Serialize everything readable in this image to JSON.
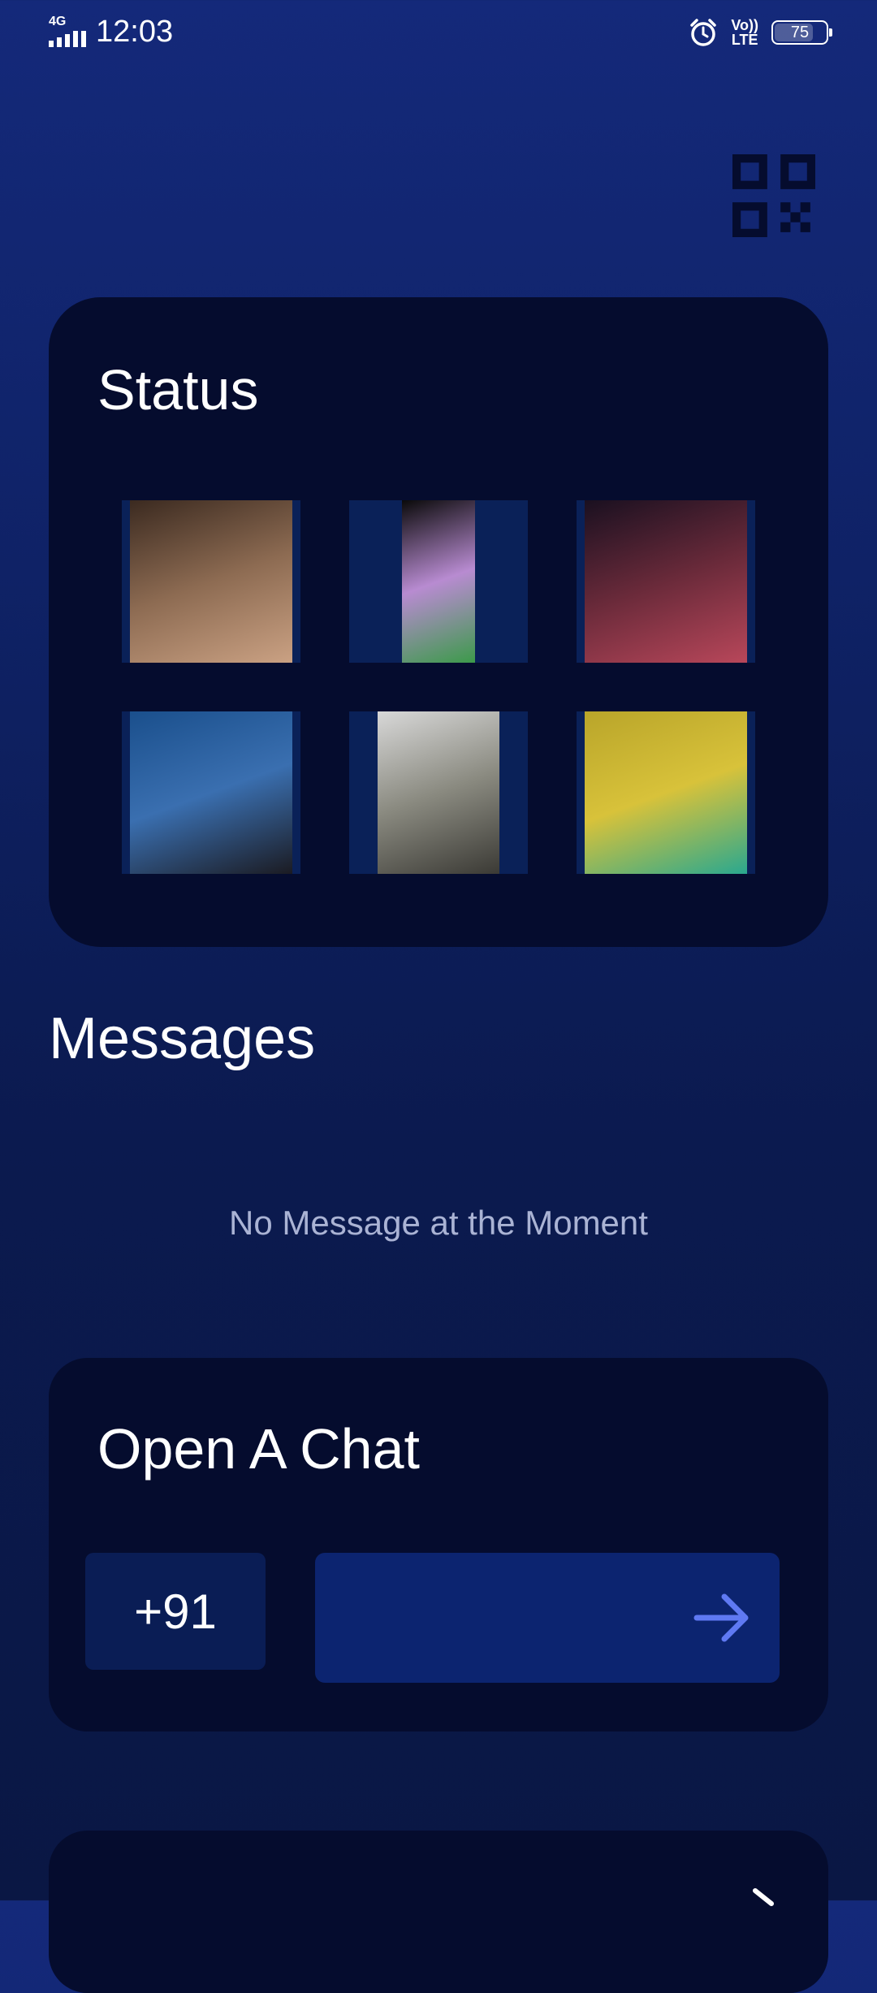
{
  "status_bar": {
    "network": "4G",
    "time": "12:03",
    "volte_top": "Vo))",
    "volte_bottom": "LTE",
    "battery": "75",
    "battery_level": 0.75
  },
  "status_section": {
    "title": "Status",
    "thumbnails": [
      {
        "name": "status-thumb-1",
        "colors": [
          "#3b2a20",
          "#8d6b52",
          "#caa183"
        ]
      },
      {
        "name": "status-thumb-2",
        "colors": [
          "#0a0a0a",
          "#b88bd1",
          "#3c9a4a"
        ]
      },
      {
        "name": "status-thumb-3",
        "colors": [
          "#1a1020",
          "#6a2a3a",
          "#b8475a"
        ]
      },
      {
        "name": "status-thumb-4",
        "colors": [
          "#1a4f8c",
          "#3a6fb0",
          "#1b1b22"
        ]
      },
      {
        "name": "status-thumb-5",
        "colors": [
          "#d8d8d8",
          "#8a8a80",
          "#3b3a35"
        ]
      },
      {
        "name": "status-thumb-6",
        "colors": [
          "#b9a52a",
          "#d8c23a",
          "#2aa88f"
        ]
      }
    ]
  },
  "messages_section": {
    "title": "Messages",
    "empty_text": "No Message at the Moment"
  },
  "open_chat": {
    "title": "Open A Chat",
    "country_code": "+91",
    "phone_value": "",
    "send_icon": "arrow-right-icon"
  },
  "colors": {
    "accent": "#5f79f2",
    "card_bg": "#050c2e",
    "input_bg": "#0c2470"
  }
}
